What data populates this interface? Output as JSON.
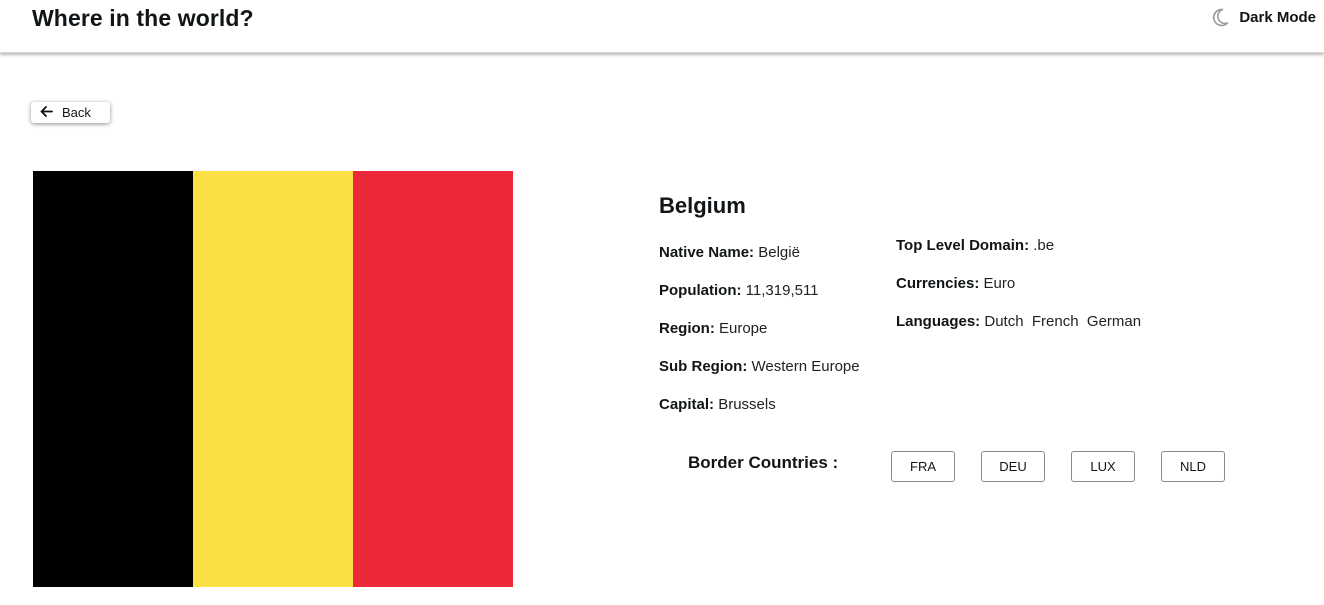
{
  "header": {
    "title": "Where in the world?",
    "theme_toggle": {
      "icon": "moon-icon",
      "label": "Dark Mode"
    }
  },
  "back_button": {
    "icon": "arrow-left-icon",
    "label": "Back"
  },
  "flag": {
    "icon": "belgium-flag",
    "colors": [
      "#000000",
      "#FAE042",
      "#ED2939"
    ]
  },
  "country": {
    "name": "Belgium",
    "details_left": [
      {
        "label": "Native Name:",
        "value": "België"
      },
      {
        "label": "Population:",
        "value": "11,319,511"
      },
      {
        "label": "Region:",
        "value": "Europe"
      },
      {
        "label": "Sub Region:",
        "value": "Western Europe"
      },
      {
        "label": "Capital:",
        "value": "Brussels"
      }
    ],
    "details_right": [
      {
        "label": "Top Level Domain:",
        "value": ".be"
      },
      {
        "label": "Currencies:",
        "value": "Euro"
      },
      {
        "label": "Languages:",
        "value": "Dutch  French  German"
      }
    ],
    "border_label": "Border Countries :",
    "borders": [
      "FRA",
      "DEU",
      "LUX",
      "NLD"
    ]
  }
}
